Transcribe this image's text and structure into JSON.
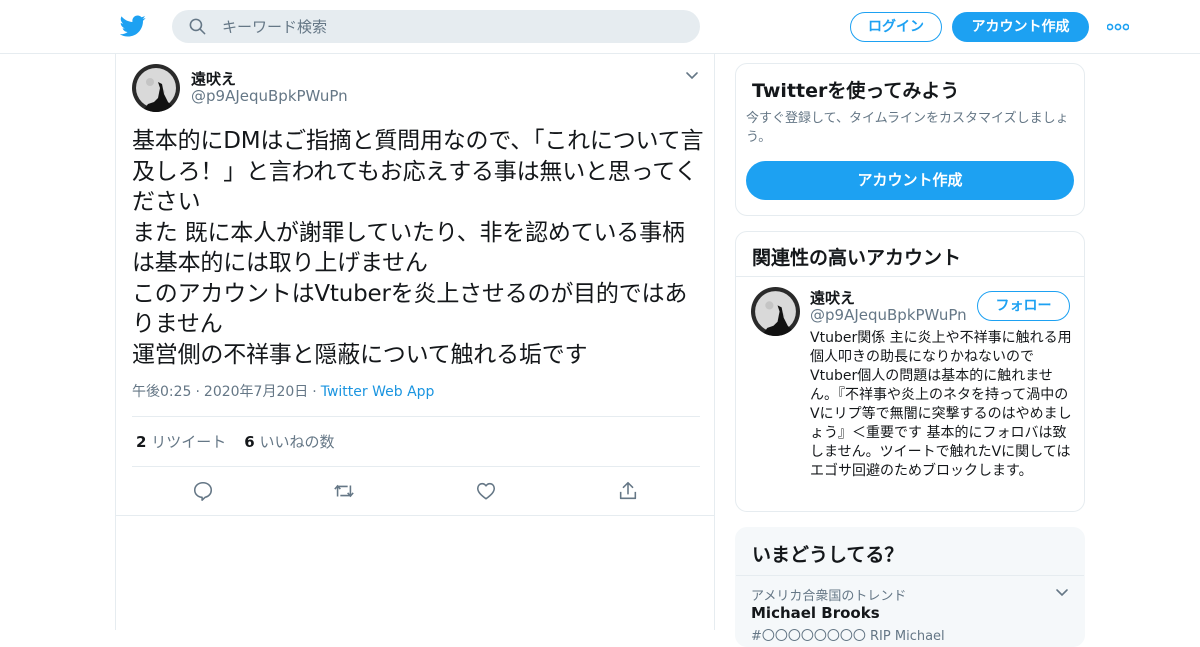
{
  "header": {
    "logo_icon": "twitter-bird-icon",
    "search_placeholder": "キーワード検索",
    "login_label": "ログイン",
    "signup_label": "アカウント作成",
    "more_icon": "more-dots-icon"
  },
  "tweet": {
    "author_name": "遠吠え",
    "author_handle": "@p9AJequBpkPWuPn",
    "text": "基本的にDMはご指摘と質問用なので、「これについて言及しろ！」と言われてもお応えする事は無いと思ってください\nまた 既に本人が謝罪していたり、非を認めている事柄は基本的には取り上げません\nこのアカウントはVtuberを炎上させるのが目的ではありません\n運営側の不祥事と隠蔽について触れる垢です",
    "time": "午後0:25",
    "date": "2020年7月20日",
    "app": "Twitter Web App",
    "retweet_count": "2",
    "retweet_label": "リツイート",
    "like_count": "6",
    "like_label": "いいねの数"
  },
  "sidebar": {
    "signup_card": {
      "title": "Twitterを使ってみよう",
      "subtitle": "今すぐ登録して、タイムラインをカスタマイズしましょう。",
      "button_label": "アカウント作成"
    },
    "related_card": {
      "title": "関連性の高いアカウント",
      "account_name": "遠吠え",
      "account_handle": "@p9AJequBpkPWuPn",
      "follow_label": "フォロー",
      "bio": "Vtuber関係 主に炎上や不祥事に触れる用 個人叩きの助長になりかねないのでVtuber個人の問題は基本的に触れません。『不祥事や炎上のネタを持って渦中のVにリプ等で無闇に突撃するのはやめましょう』＜重要です 基本的にフォロバは致しません。ツイートで触れたVに関してはエゴサ回避のためブロックします。"
    },
    "trends_card": {
      "title": "いまどうしてる？",
      "trend_location": "アメリカ合衆国のトレンド",
      "trend_name": "Michael Brooks",
      "trend_snippet": "#〇〇〇〇〇〇〇〇 RIP Michael"
    }
  },
  "colors": {
    "accent": "#1da1f2",
    "link": "#1b95e0",
    "text": "#14171a",
    "muted": "#657786",
    "border": "#e6ecf0"
  }
}
